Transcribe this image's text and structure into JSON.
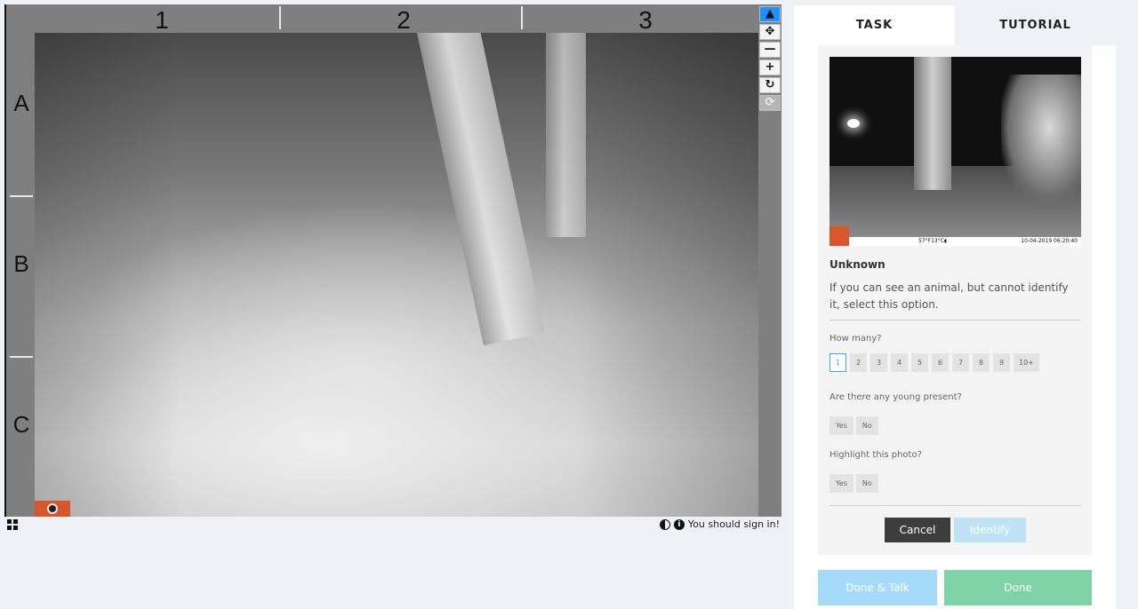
{
  "grid": {
    "columns": [
      "1",
      "2",
      "3"
    ],
    "rows": [
      "A",
      "B",
      "C"
    ]
  },
  "toolbar": {
    "tools": [
      {
        "name": "pointer",
        "icon": "cursor-icon"
      },
      {
        "name": "move",
        "icon": "move-icon"
      },
      {
        "name": "zoom-out",
        "icon": "minus-icon"
      },
      {
        "name": "zoom-in",
        "icon": "plus-icon"
      },
      {
        "name": "rotate",
        "icon": "rotate-icon"
      },
      {
        "name": "reset",
        "icon": "refresh-icon"
      }
    ]
  },
  "footer": {
    "signin_text": "You should sign in!"
  },
  "tabs": [
    {
      "label": "TASK",
      "active": true
    },
    {
      "label": "TUTORIAL",
      "active": false
    }
  ],
  "species": {
    "name": "Unknown",
    "description": "If you can see an animal, but cannot identify it, select this option.",
    "thumbnail_caption_center": "57°F13°C◖",
    "thumbnail_caption_right": "10-04-2019 06:20:40"
  },
  "questions": {
    "how_many": {
      "label": "How many?",
      "options": [
        "1",
        "2",
        "3",
        "4",
        "5",
        "6",
        "7",
        "8",
        "9",
        "10+"
      ],
      "selected": "1"
    },
    "young": {
      "label": "Are there any young present?",
      "options": [
        "Yes",
        "No"
      ]
    },
    "highlight": {
      "label": "Highlight this photo?",
      "options": [
        "Yes",
        "No"
      ]
    }
  },
  "actions": {
    "cancel": "Cancel",
    "identify": "Identify",
    "done_talk": "Done & Talk",
    "done": "Done"
  },
  "colors": {
    "active_tool": "#1e90ff",
    "selected_number_border": "#4aa3df",
    "done_talk_bg": "#a6dafa",
    "done_bg": "#7fd1a6",
    "identify_bg": "#bfe3f6",
    "cancel_bg": "#3d3d3d",
    "brand_badge": "#d8562a"
  }
}
